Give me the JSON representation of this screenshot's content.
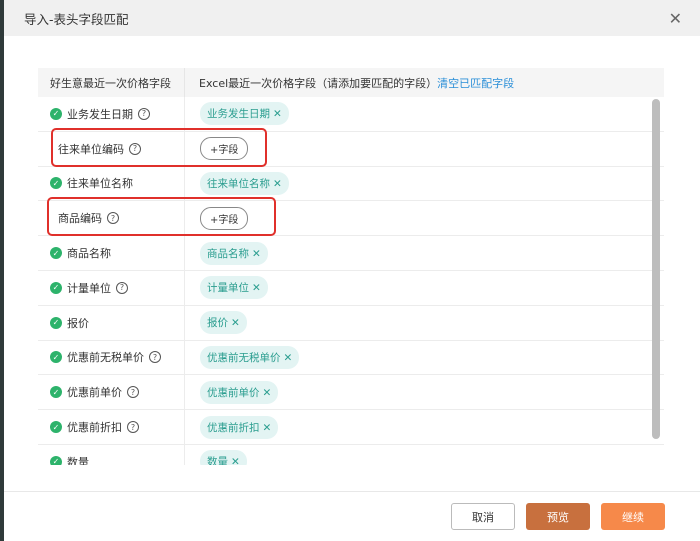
{
  "dialog": {
    "title": "导入-表头字段匹配"
  },
  "table": {
    "col1": "好生意最近一次价格字段",
    "col2": "Excel最近一次价格字段（请添加要匹配的字段）",
    "clear_link": "清空已匹配字段",
    "rows": [
      {
        "field": "业务发生日期",
        "matched": true,
        "help": true,
        "tag": "业务发生日期"
      },
      {
        "field": "往来单位编码",
        "matched": false,
        "help": true,
        "add": "+字段"
      },
      {
        "field": "往来单位名称",
        "matched": true,
        "help": false,
        "tag": "往来单位名称"
      },
      {
        "field": "商品编码",
        "matched": false,
        "help": true,
        "add": "+字段"
      },
      {
        "field": "商品名称",
        "matched": true,
        "help": false,
        "tag": "商品名称"
      },
      {
        "field": "计量单位",
        "matched": true,
        "help": true,
        "tag": "计量单位"
      },
      {
        "field": "报价",
        "matched": true,
        "help": false,
        "tag": "报价"
      },
      {
        "field": "优惠前无税单价",
        "matched": true,
        "help": true,
        "tag": "优惠前无税单价"
      },
      {
        "field": "优惠前单价",
        "matched": true,
        "help": true,
        "tag": "优惠前单价"
      },
      {
        "field": "优惠前折扣",
        "matched": true,
        "help": true,
        "tag": "优惠前折扣"
      },
      {
        "field": "数量",
        "matched": true,
        "help": false,
        "tag": "数量"
      }
    ]
  },
  "buttons": {
    "cancel": "取消",
    "preview": "预览",
    "continue": "继续"
  },
  "colors": {
    "preview": "#c8703e",
    "continue": "#f6894a",
    "matched": "#2db36b",
    "tag": "#2a9d8f"
  }
}
